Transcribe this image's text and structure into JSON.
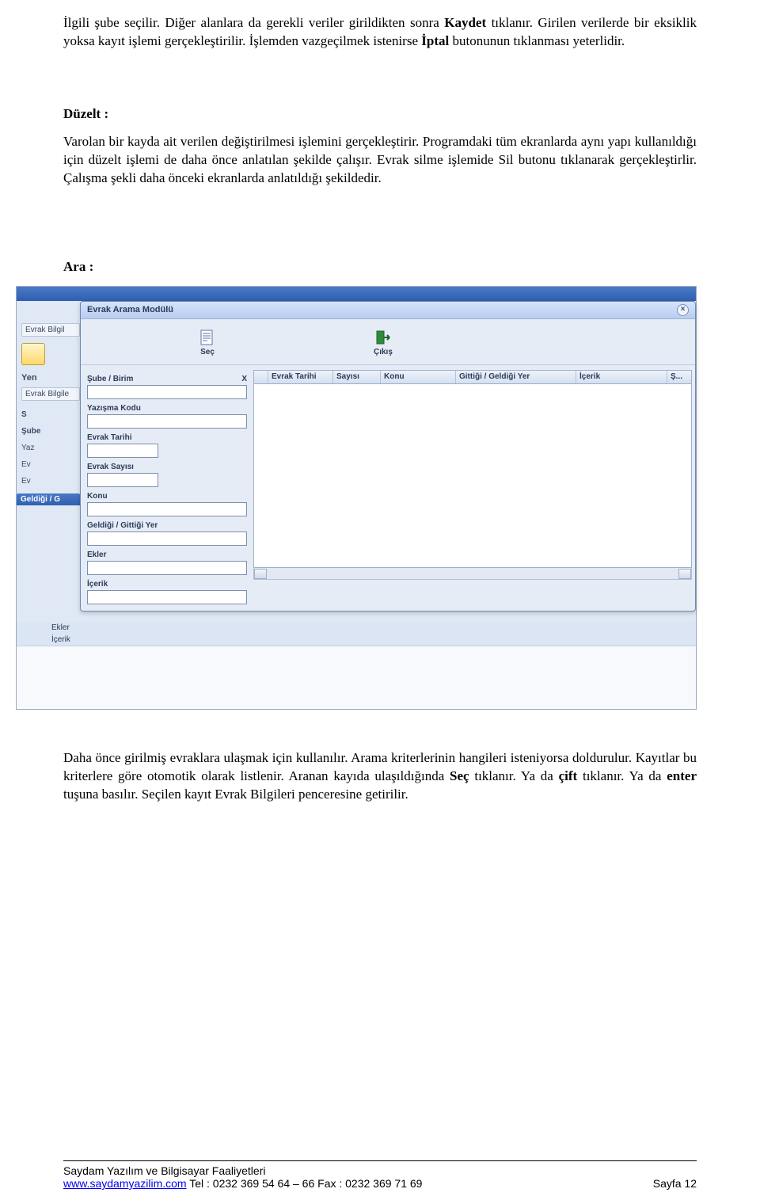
{
  "para1_prefix": "İlgili şube seçilir. Diğer alanlara da gerekli veriler girildikten sonra ",
  "para1_bold1": "Kaydet",
  "para1_mid": " tıklanır. Girilen verilerde bir eksiklik yoksa kayıt işlemi gerçekleştirilir. İşlemden vazgeçilmek istenirse ",
  "para1_bold2": "İptal",
  "para1_suffix": " butonunun tıklanması yeterlidir.",
  "heading_duzelt": "Düzelt :",
  "para_duzelt": "Varolan bir kayda ait verilen değiştirilmesi işlemini gerçekleştirir. Programdaki tüm ekranlarda aynı yapı kullanıldığı için düzelt işlemi de daha önce anlatılan şekilde çalışır. Evrak silme işlemide Sil butonu tıklanarak gerçekleştirlir. Çalışma şekli daha önceki ekranlarda anlatıldığı şekildedir.",
  "heading_ara": "Ara :",
  "para2_prefix": "Daha önce girilmiş evraklara ulaşmak için kullanılır. Arama kriterlerinin hangileri isteniyorsa doldurulur. Kayıtlar bu kriterlere göre otomotik olarak listlenir. Aranan kayıda ulaşıldığında ",
  "para2_bold1": "Seç",
  "para2_mid1": " tıklanır. Ya da ",
  "para2_bold2": "çift",
  "para2_mid2": " tıklanır. Ya da ",
  "para2_bold3": "enter",
  "para2_suffix": " tuşuna basılır. Seçilen kayıt Evrak Bilgileri penceresine getirilir.",
  "modal": {
    "title": "Evrak Arama Modülü",
    "toolbar": {
      "sec": "Seç",
      "cikis": "Çıkış"
    },
    "form": {
      "sube_label": "Şube / Birim",
      "sube_x": "X",
      "yazisma": "Yazışma Kodu",
      "tarih": "Evrak Tarihi",
      "sayi": "Evrak Sayısı",
      "konu": "Konu",
      "geldigi": "Geldiği / Gittiği Yer",
      "ekler": "Ekler",
      "icerik": "İçerik"
    },
    "grid": {
      "col_tarih": "Evrak Tarihi",
      "col_sayi": "Sayısı",
      "col_konu": "Konu",
      "col_yer": "Gittiği / Geldiği Yer",
      "col_icerik": "İçerik",
      "col_s": "Ş..."
    }
  },
  "left": {
    "tab1": "Evrak Bilgil",
    "yen": "Yen",
    "tab2": "Evrak Bilgile",
    "s": "S",
    "sube": "Şube",
    "yaz": "Yaz",
    "ev1": "Ev",
    "ev2": "Ev",
    "dark": "Geldiği / G",
    "ekler": "Ekler",
    "icerik": "İçerik"
  },
  "footer": {
    "line1": "Saydam Yazılım ve Bilgisayar Faaliyetleri",
    "url": "www.saydamyazilim.com",
    "tel": " Tel  : 0232 369 54 64 – 66 Fax : 0232 369 71 69",
    "page": "Sayfa 12"
  }
}
